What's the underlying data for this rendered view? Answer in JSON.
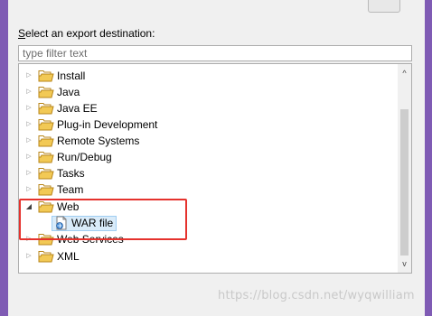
{
  "header": {
    "label_accel": "S",
    "label_rest": "elect an export destination:"
  },
  "filter": {
    "placeholder": "type filter text",
    "value": ""
  },
  "tree": {
    "items": [
      {
        "label": "Install",
        "expanded": false
      },
      {
        "label": "Java",
        "expanded": false
      },
      {
        "label": "Java EE",
        "expanded": false
      },
      {
        "label": "Plug-in Development",
        "expanded": false
      },
      {
        "label": "Remote Systems",
        "expanded": false
      },
      {
        "label": "Run/Debug",
        "expanded": false
      },
      {
        "label": "Tasks",
        "expanded": false
      },
      {
        "label": "Team",
        "expanded": false
      },
      {
        "label": "Web",
        "expanded": true
      },
      {
        "label": "WAR file",
        "child": true,
        "selected": true
      },
      {
        "label": "Web Services",
        "expanded": false
      },
      {
        "label": "XML",
        "expanded": false
      }
    ]
  },
  "watermark": "https://blog.csdn.net/wyqwilliam",
  "colors": {
    "folder": "#e8b93a",
    "highlight": "#e5322d",
    "selection": "#d9ebf9"
  }
}
